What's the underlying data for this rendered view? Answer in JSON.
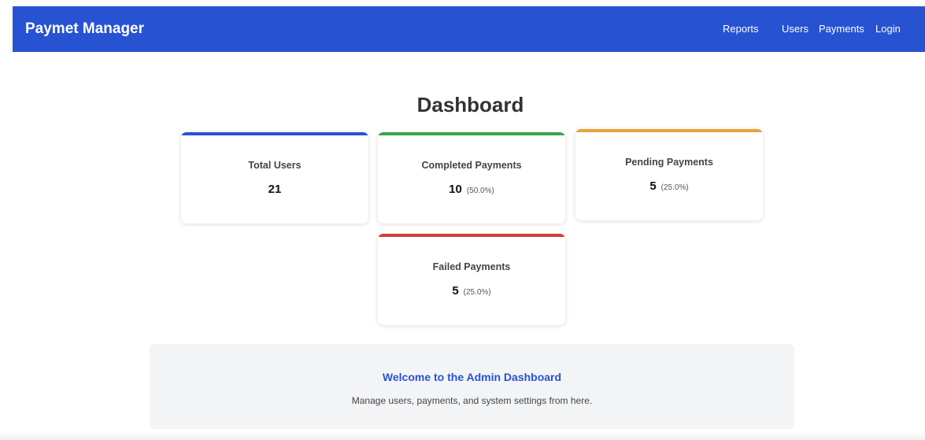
{
  "navbar": {
    "brand": "Paymet Manager",
    "links": [
      {
        "label": "Reports"
      },
      {
        "label": "Users"
      },
      {
        "label": "Payments"
      },
      {
        "label": "Login"
      }
    ]
  },
  "page": {
    "title": "Dashboard"
  },
  "stats": {
    "total_users": {
      "label": "Total Users",
      "value": "21",
      "accent": "#2753d3"
    },
    "completed": {
      "label": "Completed Payments",
      "value": "10",
      "percent": "(50.0%)",
      "accent": "#3fa34d"
    },
    "pending": {
      "label": "Pending Payments",
      "value": "5",
      "percent": "(25.0%)",
      "accent": "#e8a33d"
    },
    "failed": {
      "label": "Failed Payments",
      "value": "5",
      "percent": "(25.0%)",
      "accent": "#d23c37"
    }
  },
  "welcome": {
    "title": "Welcome to the Admin Dashboard",
    "text": "Manage users, payments, and system settings from here."
  }
}
